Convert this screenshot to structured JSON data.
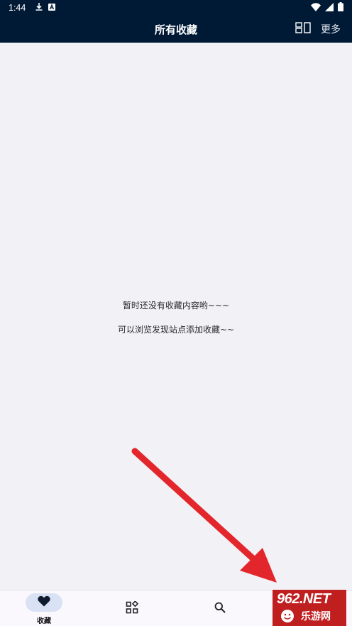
{
  "status_bar": {
    "time": "1:44",
    "icons": [
      "download-icon",
      "a-icon"
    ],
    "right_icons": [
      "wifi-icon",
      "signal-icon",
      "battery-icon"
    ]
  },
  "app_bar": {
    "title": "所有收藏",
    "layout_icon": "layout-toggle-icon",
    "more_label": "更多"
  },
  "empty_state": {
    "line1": "暂时还没有收藏内容哟~~~",
    "line2": "可以浏览发现站点添加收藏~~"
  },
  "bottom_nav": {
    "items": [
      {
        "label": "收藏",
        "icon": "heart-icon",
        "selected": true
      },
      {
        "label": "",
        "icon": "discover-grid-icon",
        "selected": false
      },
      {
        "label": "",
        "icon": "search-icon",
        "selected": false
      }
    ]
  },
  "watermark": {
    "brand": "962.NET",
    "sub": "乐游网"
  },
  "colors": {
    "header_bg": "#001a36",
    "page_bg": "#f2f1f6",
    "nav_bg": "#fbf8fd",
    "nav_selected_pill": "#d9e2f5",
    "arrow": "#e3262b"
  }
}
